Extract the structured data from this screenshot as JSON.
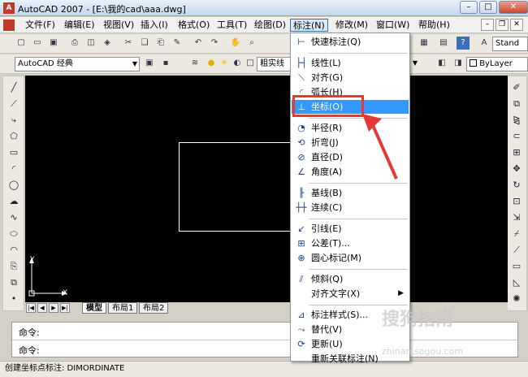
{
  "window": {
    "title": "AutoCAD 2007 - [E:\\我的cad\\aaa.dwg]",
    "app_icon": "A"
  },
  "menubar": {
    "file": "文件(F)",
    "edit": "编辑(E)",
    "view": "视图(V)",
    "insert": "插入(I)",
    "format": "格式(O)",
    "tools": "工具(T)",
    "draw": "绘图(D)",
    "dimension": "标注(N)",
    "modify": "修改(M)",
    "window": "窗口(W)",
    "help": "帮助(H)"
  },
  "toolbar": {
    "workspace": "AutoCAD 经典",
    "layer_name": "粗实线",
    "text_style": "Stand",
    "color": "ByLayer"
  },
  "dimension_menu": {
    "quick_dim": "快速标注(Q)",
    "linear": "线性(L)",
    "aligned": "对齐(G)",
    "arc_length": "弧长(H)",
    "ordinate": "坐标(O)",
    "radius": "半径(R)",
    "jogged": "折弯(J)",
    "diameter": "直径(D)",
    "angular": "角度(A)",
    "baseline": "基线(B)",
    "continue": "连续(C)",
    "leader": "引线(E)",
    "tolerance": "公差(T)...",
    "center_mark": "圆心标记(M)",
    "oblique": "倾斜(Q)",
    "align_text": "对齐文字(X)",
    "dim_style": "标注样式(S)...",
    "override": "替代(V)",
    "update": "更新(U)",
    "reassociate": "重新关联标注(N)"
  },
  "layout_tabs": [
    "模型",
    "布局1",
    "布局2"
  ],
  "ucs": {
    "x": "X",
    "y": "Y"
  },
  "command": {
    "line1": "命令:",
    "line2": "命令:"
  },
  "status": "创建坐标点标注:   DIMORDINATE",
  "watermark": {
    "brand": "搜狗指南",
    "url": "zhinan.sogou.com"
  },
  "colors": {
    "highlight": "#3399ff",
    "annotation": "#e53935"
  }
}
